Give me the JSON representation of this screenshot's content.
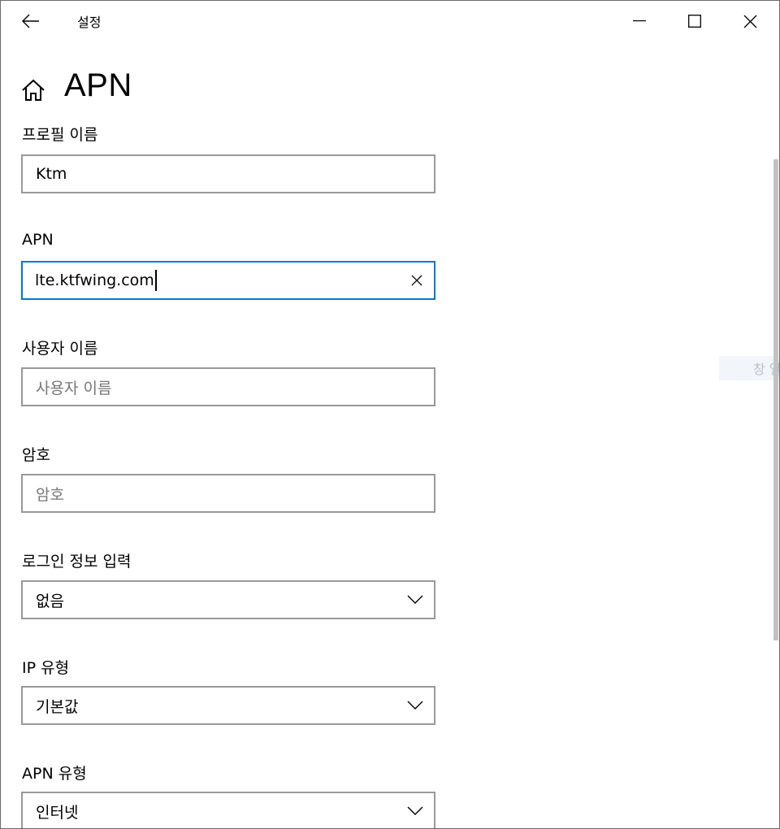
{
  "window": {
    "app_title": "설정",
    "controls": {
      "minimize": "minimize-icon",
      "maximize": "maximize-icon",
      "close": "close-icon"
    }
  },
  "header": {
    "home_icon": "home-icon",
    "title": "APN"
  },
  "form": {
    "profile_name": {
      "label": "프로필 이름",
      "value": "Ktm"
    },
    "apn": {
      "label": "APN",
      "value": "lte.ktfwing.com"
    },
    "username": {
      "label": "사용자 이름",
      "value": "",
      "placeholder": "사용자 이름"
    },
    "password": {
      "label": "암호",
      "value": "",
      "placeholder": "암호"
    },
    "login_info": {
      "label": "로그인 정보 입력",
      "selected": "없음"
    },
    "ip_type": {
      "label": "IP 유형",
      "selected": "기본값"
    },
    "apn_type": {
      "label": "APN 유형",
      "selected": "인터넷"
    }
  },
  "side_hint": {
    "text": "창 열"
  },
  "colors": {
    "focus_border": "#0078d7",
    "field_border": "#999999",
    "placeholder": "#767676"
  }
}
